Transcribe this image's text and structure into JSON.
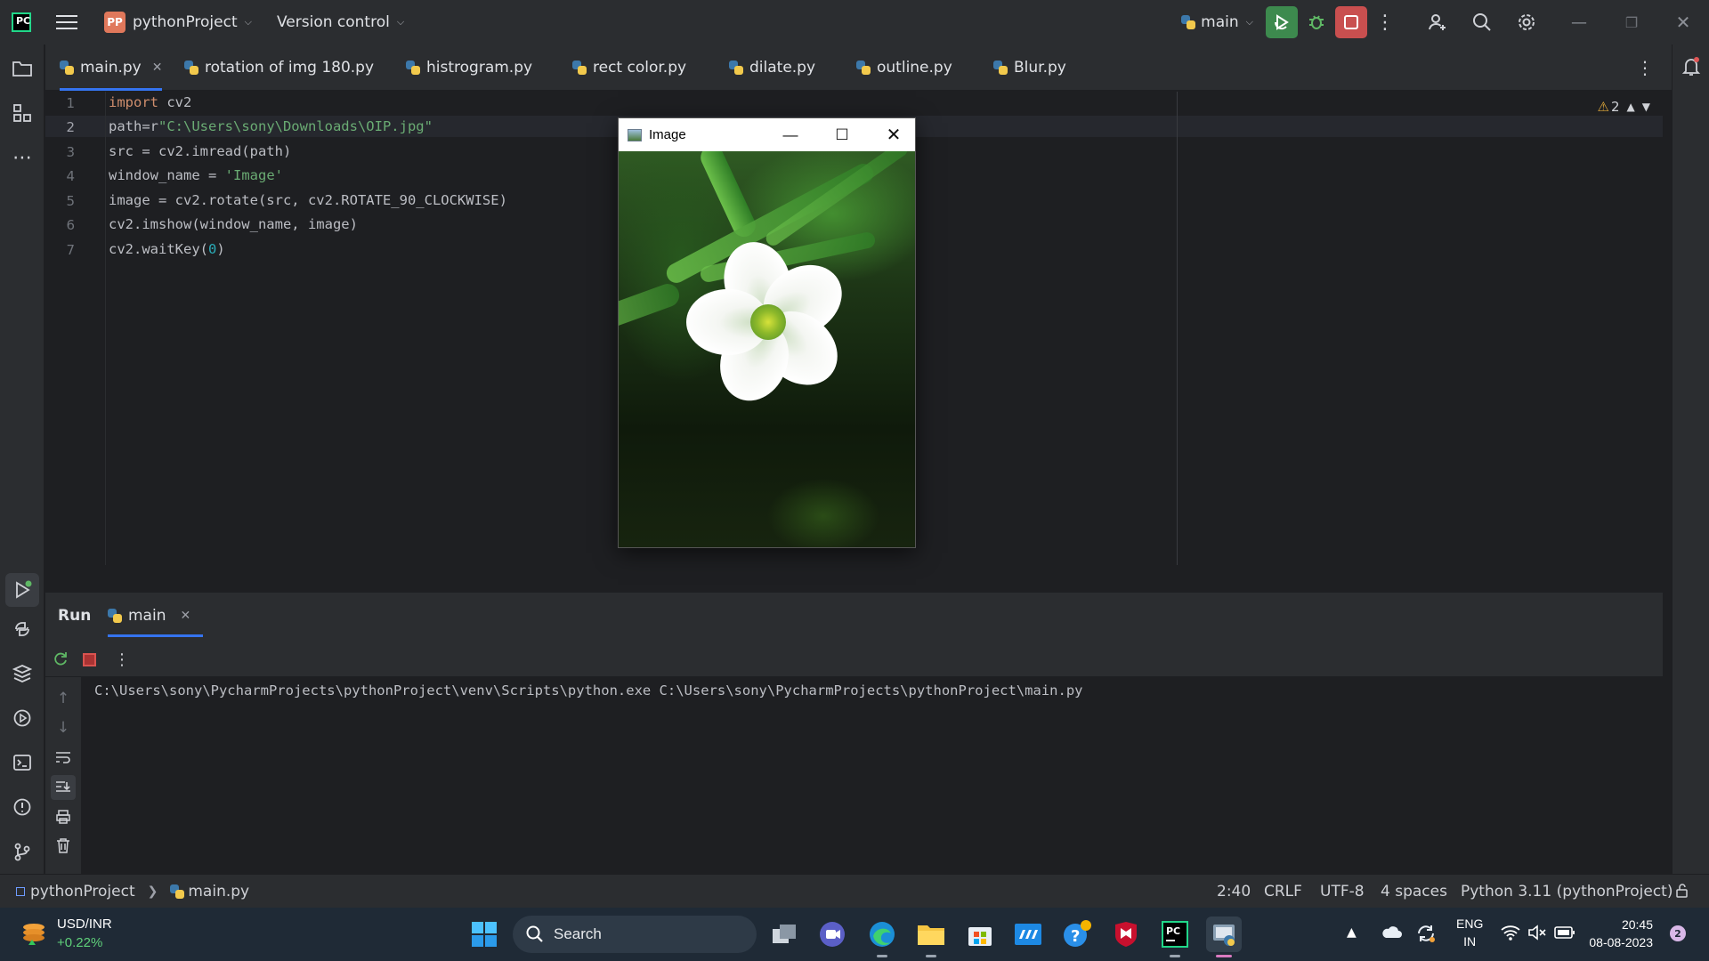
{
  "titlebar": {
    "project_badge": "PP",
    "project_name": "pythonProject",
    "version_control": "Version control",
    "run_config": "main"
  },
  "tabs": [
    {
      "label": "main.py",
      "active": true
    },
    {
      "label": "rotation of img 180.py"
    },
    {
      "label": "histrogram.py"
    },
    {
      "label": "rect color.py"
    },
    {
      "label": "dilate.py"
    },
    {
      "label": "outline.py"
    },
    {
      "label": "Blur.py"
    }
  ],
  "editor": {
    "line_numbers": [
      "1",
      "2",
      "3",
      "4",
      "5",
      "6",
      "7"
    ],
    "lines": [
      {
        "kw": "import",
        "rest": " cv2"
      },
      {
        "a": "path=r",
        "str": "\"C:\\Users\\sony\\Downloads\\OIP.jpg\""
      },
      {
        "a": "src = cv2.imread(path)"
      },
      {
        "a": "window_name = ",
        "str": "'Image'"
      },
      {
        "a": "image = cv2.rotate(src, cv2.ROTATE_90_CLOCKWISE)"
      },
      {
        "a": "cv2.imshow(window_name, image)"
      },
      {
        "a": "cv2.waitKey(",
        "num": "0",
        "b": ")"
      }
    ],
    "warnings_count": "2"
  },
  "image_window": {
    "title": "Image"
  },
  "run_panel": {
    "title": "Run",
    "tab_label": "main",
    "console_output": "C:\\Users\\sony\\PycharmProjects\\pythonProject\\venv\\Scripts\\python.exe C:\\Users\\sony\\PycharmProjects\\pythonProject\\main.py"
  },
  "statusbar": {
    "breadcrumb_project": "pythonProject",
    "breadcrumb_file": "main.py",
    "position": "2:40",
    "line_sep": "CRLF",
    "encoding": "UTF-8",
    "indent": "4 spaces",
    "interpreter": "Python 3.11 (pythonProject)"
  },
  "taskbar": {
    "widget_title": "USD/INR",
    "widget_value": "+0.22%",
    "search_placeholder": "Search",
    "lang_top": "ENG",
    "lang_bottom": "IN",
    "time": "20:45",
    "date": "08-08-2023",
    "notification_count": "2"
  },
  "colors": {
    "accent": "#3574f0",
    "run_green": "#3d8a4e",
    "stop_red": "#c94f4f"
  }
}
